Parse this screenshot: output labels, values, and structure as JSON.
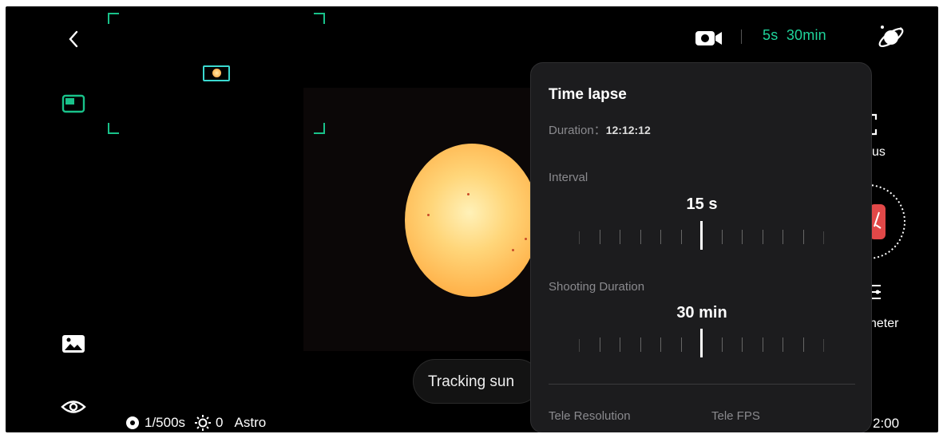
{
  "top_bar": {
    "status_interval": "5s",
    "status_duration": "30min"
  },
  "panel": {
    "title": "Time lapse",
    "duration_label": "Duration：",
    "duration_value": "12:12:12",
    "interval_label": "Interval",
    "interval_value": "15 s",
    "shooting_label": "Shooting Duration",
    "shooting_value": "30 min",
    "tele_resolution_label": "Tele Resolution",
    "tele_fps_label": "Tele FPS"
  },
  "right_controls": {
    "focus_label_partial": "us",
    "meter_label_partial": "neter",
    "time_partial": "2:00"
  },
  "toast": {
    "text": "Tracking sun"
  },
  "bottom_info": {
    "shutter": "1/500s",
    "exposure": "0",
    "mode": "Astro"
  },
  "colors": {
    "accent": "#1fd39a",
    "record": "#e14848",
    "panel_bg": "#1c1c1e"
  },
  "icons": [
    "back-icon",
    "layout-icon",
    "gallery-icon",
    "eye-icon",
    "video-camera-icon",
    "satellite-icon",
    "focus-icon",
    "record-icon",
    "meter-icon",
    "aperture-icon",
    "brightness-icon"
  ]
}
